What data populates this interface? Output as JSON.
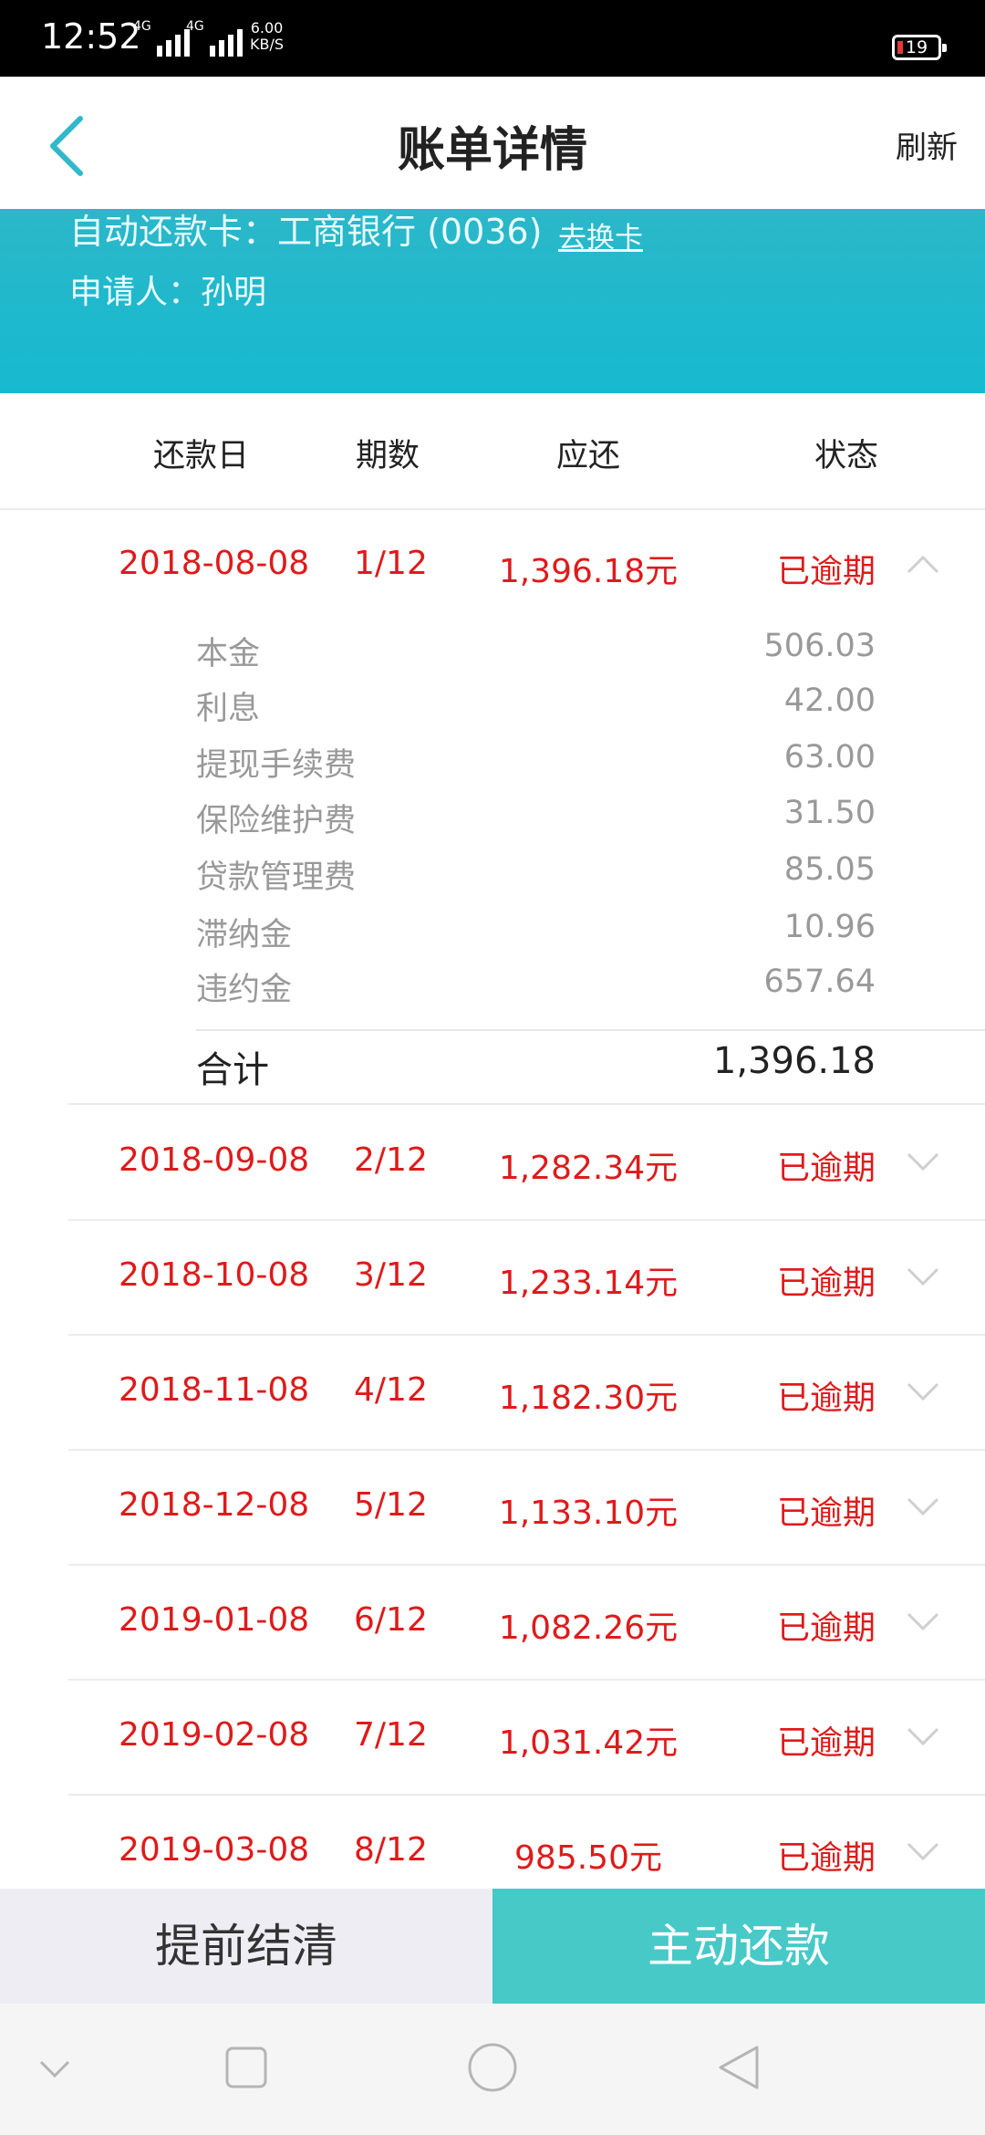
{
  "status_bar": {
    "time": "12:52",
    "sim1_label": "4G",
    "sim2_label": "4G",
    "net_speed": "6.00",
    "net_unit": "KB/S",
    "battery": "19"
  },
  "header": {
    "title": "账单详情",
    "refresh_label": "刷新"
  },
  "banner": {
    "card_text": "自动还款卡：工商银行 (0036)",
    "swap_card_label": "去换卡",
    "applicant_text": "申请人：孙明"
  },
  "table": {
    "headers": [
      "还款日",
      "期数",
      "应还",
      "状态"
    ],
    "rows": [
      {
        "date": "2018-08-08",
        "period": "1/12",
        "amount": "1,396.18元",
        "status": "已逾期",
        "expanded": true
      },
      {
        "date": "2018-09-08",
        "period": "2/12",
        "amount": "1,282.34元",
        "status": "已逾期"
      },
      {
        "date": "2018-10-08",
        "period": "3/12",
        "amount": "1,233.14元",
        "status": "已逾期"
      },
      {
        "date": "2018-11-08",
        "period": "4/12",
        "amount": "1,182.30元",
        "status": "已逾期"
      },
      {
        "date": "2018-12-08",
        "period": "5/12",
        "amount": "1,133.10元",
        "status": "已逾期"
      },
      {
        "date": "2019-01-08",
        "period": "6/12",
        "amount": "1,082.26元",
        "status": "已逾期"
      },
      {
        "date": "2019-02-08",
        "period": "7/12",
        "amount": "1,031.42元",
        "status": "已逾期"
      },
      {
        "date": "2019-03-08",
        "period": "8/12",
        "amount": "985.50元",
        "status": "已逾期"
      }
    ],
    "details": [
      {
        "label": "本金",
        "value": "506.03"
      },
      {
        "label": "利息",
        "value": "42.00"
      },
      {
        "label": "提现手续费",
        "value": "63.00"
      },
      {
        "label": "保险维护费",
        "value": "31.50"
      },
      {
        "label": "贷款管理费",
        "value": "85.05"
      },
      {
        "label": "滞纳金",
        "value": "10.96"
      },
      {
        "label": "违约金",
        "value": "657.64"
      }
    ],
    "total": {
      "label": "合计",
      "value": "1,396.18"
    }
  },
  "actions": {
    "settle_label": "提前结清",
    "repay_label": "主动还款"
  },
  "colors": {
    "accent_teal": "#16bad0",
    "overdue_red": "#de1b1b",
    "repay_button": "#47c9c7"
  }
}
